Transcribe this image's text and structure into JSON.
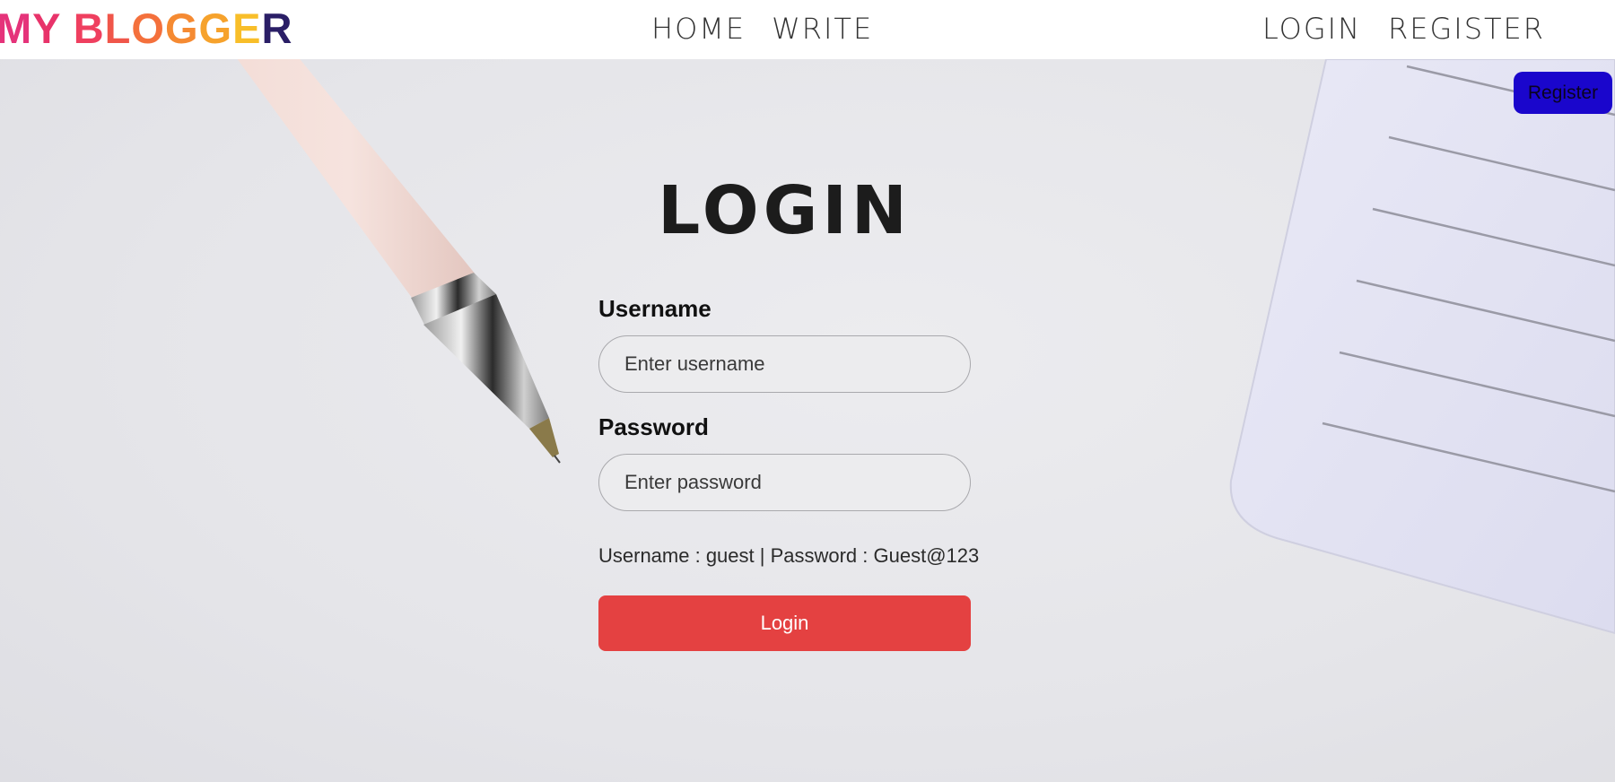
{
  "nav": {
    "brand": [
      "M",
      "Y",
      " ",
      "B",
      "L",
      "O",
      "G",
      "G",
      "E",
      "R"
    ],
    "brand_colors": [
      "#e5337a",
      "#e8336a",
      "#ffffff",
      "#ef3f5f",
      "#f0564a",
      "#f4703c",
      "#f58a32",
      "#f6a22c",
      "#f8be29",
      "#2a1e66"
    ],
    "center_links": [
      "HOME",
      "WRITE"
    ],
    "right_links": [
      "LOGIN",
      "REGISTER"
    ]
  },
  "register_badge": {
    "label": "Register",
    "color": "#1a06cc"
  },
  "login": {
    "title": "LOGIN",
    "username_label": "Username",
    "username_placeholder": "Enter username",
    "password_label": "Password",
    "password_placeholder": "Enter password",
    "hint": "Username : guest | Password : Guest@123",
    "button_label": "Login",
    "button_color": "#e44141"
  },
  "decor": {
    "pen_icon": "pen-icon",
    "notepad_icon": "notepad-icon"
  }
}
